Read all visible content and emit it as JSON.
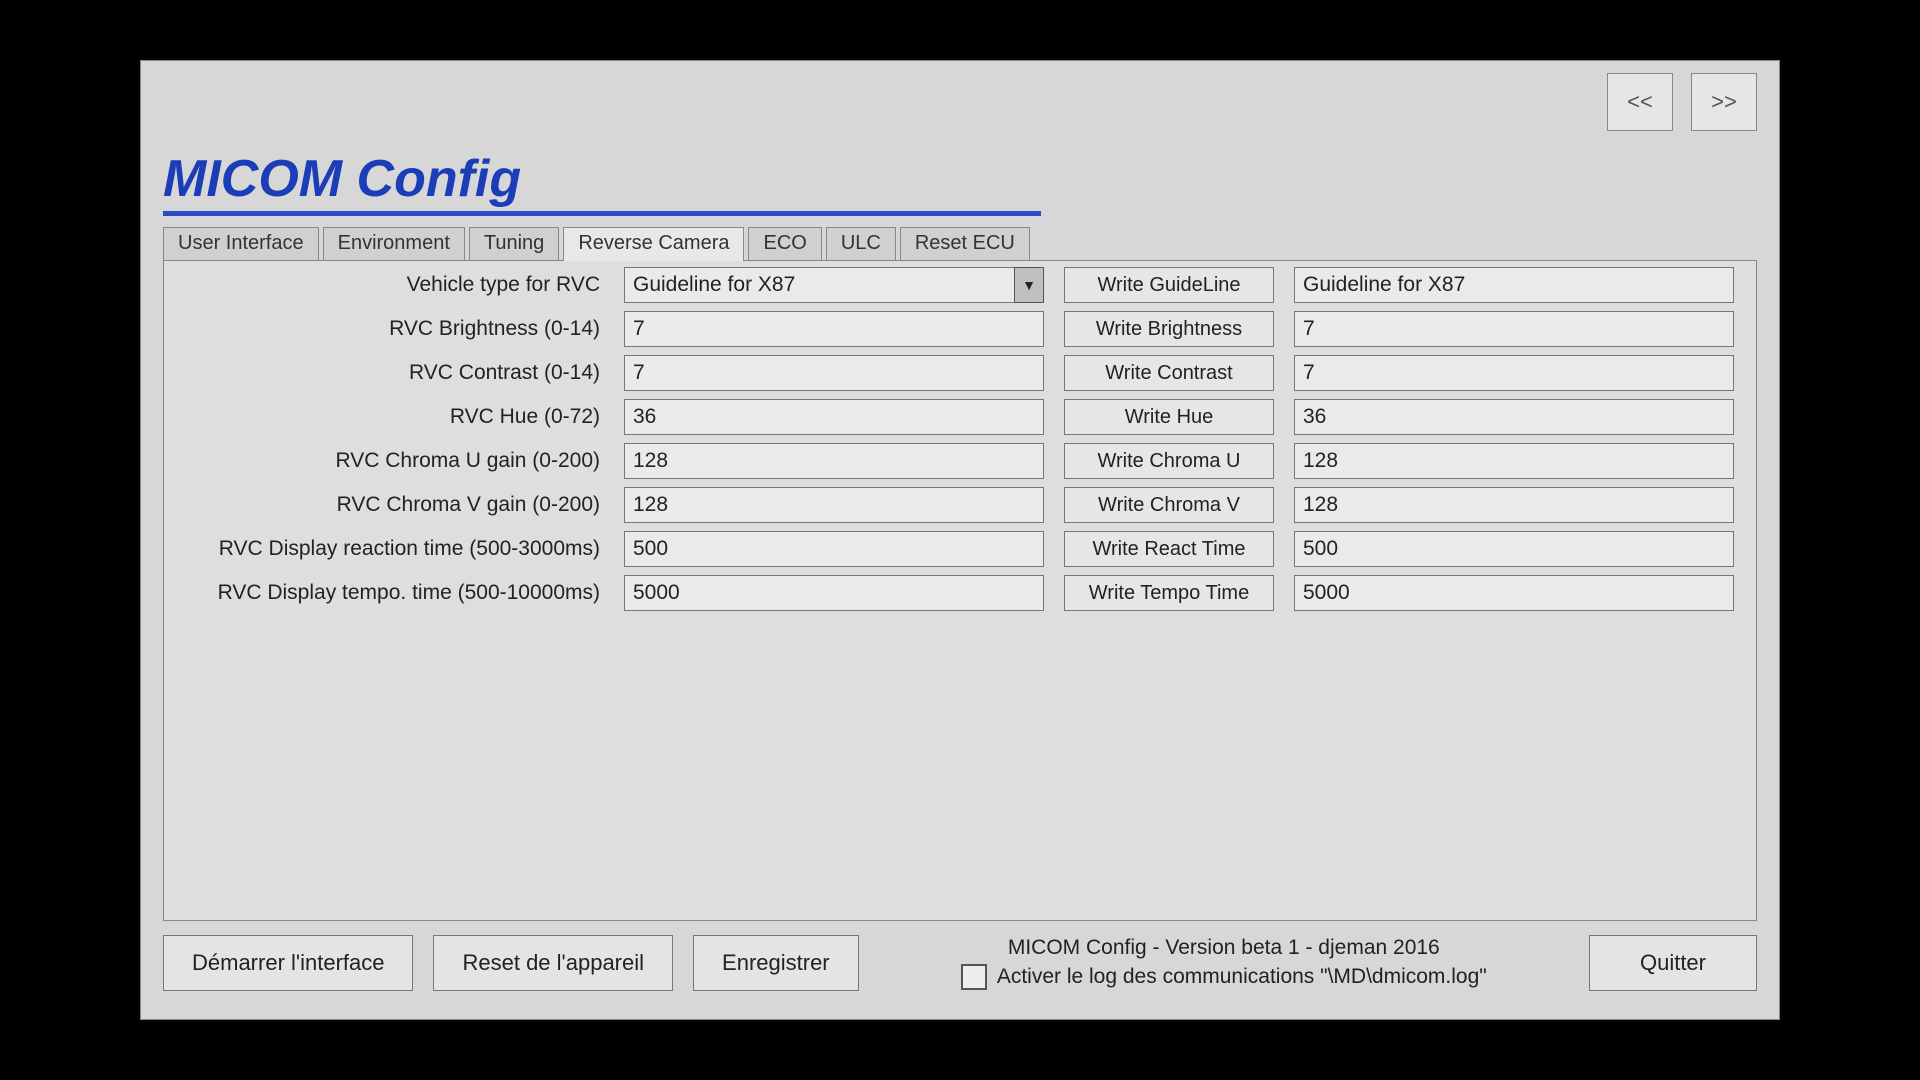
{
  "nav": {
    "prev": "<<",
    "next": ">>"
  },
  "title": "MICOM Config",
  "tabs": {
    "user_interface": "User Interface",
    "environment": "Environment",
    "tuning": "Tuning",
    "reverse_camera": "Reverse Camera",
    "eco": "ECO",
    "ulc": "ULC",
    "reset_ecu": "Reset ECU"
  },
  "labels": {
    "vehicle_type": "Vehicle type for RVC",
    "brightness": "RVC Brightness (0-14)",
    "contrast": "RVC Contrast (0-14)",
    "hue": "RVC Hue (0-72)",
    "chroma_u": "RVC Chroma U gain (0-200)",
    "chroma_v": "RVC Chroma V gain (0-200)",
    "react_time": "RVC Display reaction time (500-3000ms)",
    "tempo_time": "RVC Display tempo. time (500-10000ms)"
  },
  "values": {
    "vehicle_type": "Guideline for X87",
    "brightness": "7",
    "contrast": "7",
    "hue": "36",
    "chroma_u": "128",
    "chroma_v": "128",
    "react_time": "500",
    "tempo_time": "5000"
  },
  "write_buttons": {
    "guideline": "Write GuideLine",
    "brightness": "Write Brightness",
    "contrast": "Write Contrast",
    "hue": "Write Hue",
    "chroma_u": "Write Chroma U",
    "chroma_v": "Write Chroma V",
    "react_time": "Write React Time",
    "tempo_time": "Write Tempo Time"
  },
  "readouts": {
    "guideline": "Guideline for X87",
    "brightness": "7",
    "contrast": "7",
    "hue": "36",
    "chroma_u": "128",
    "chroma_v": "128",
    "react_time": "500",
    "tempo_time": "5000"
  },
  "footer": {
    "start_interface": "Démarrer l'interface",
    "reset_device": "Reset de l'appareil",
    "save": "Enregistrer",
    "version": "MICOM Config - Version beta 1 - djeman 2016",
    "log_label": "Activer le log des communications \"\\MD\\dmicom.log\"",
    "quit": "Quitter"
  }
}
